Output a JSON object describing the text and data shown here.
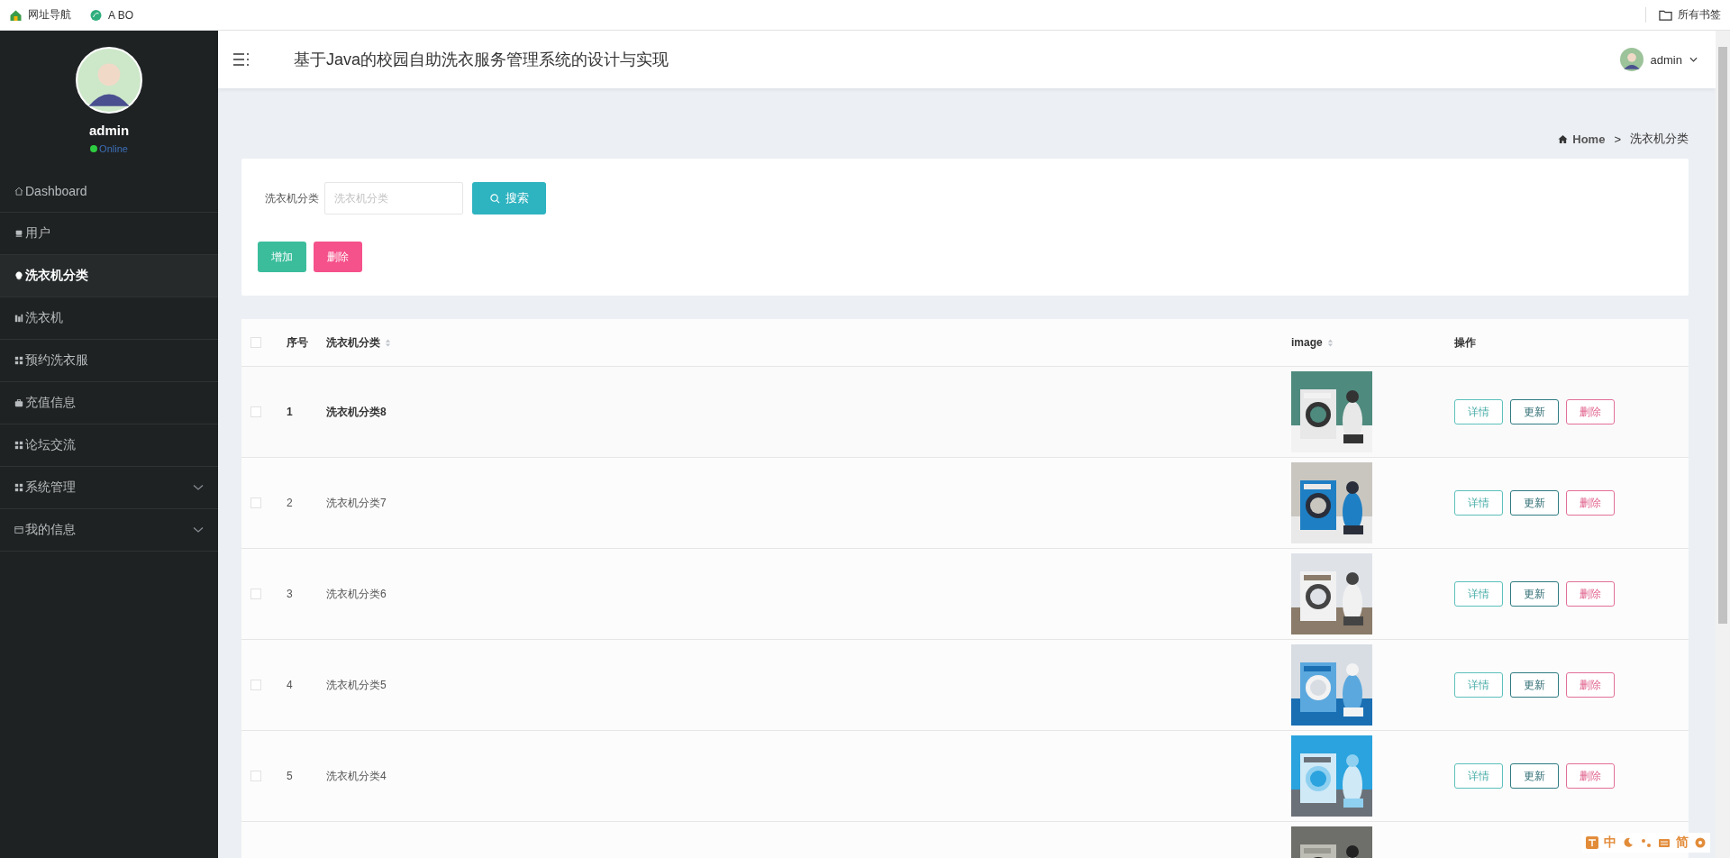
{
  "bookmarks_bar": {
    "items": [
      {
        "label": "网址导航"
      },
      {
        "label": "A BO"
      }
    ],
    "all_bookmarks": "所有书签"
  },
  "sidebar": {
    "user": {
      "name": "admin",
      "status": "Online"
    },
    "items": [
      {
        "label": "Dashboard",
        "selected": false,
        "has_submenu": false
      },
      {
        "label": "用户",
        "selected": false,
        "has_submenu": false
      },
      {
        "label": "洗衣机分类",
        "selected": true,
        "has_submenu": false
      },
      {
        "label": "洗衣机",
        "selected": false,
        "has_submenu": false
      },
      {
        "label": "预约洗衣服",
        "selected": false,
        "has_submenu": false
      },
      {
        "label": "充值信息",
        "selected": false,
        "has_submenu": false
      },
      {
        "label": "论坛交流",
        "selected": false,
        "has_submenu": false
      },
      {
        "label": "系统管理",
        "selected": false,
        "has_submenu": true
      },
      {
        "label": "我的信息",
        "selected": false,
        "has_submenu": true
      }
    ]
  },
  "header": {
    "title": "基于Java的校园自助洗衣服务管理系统的设计与实现",
    "user": "admin"
  },
  "breadcrumb": {
    "home": "Home",
    "separator": ">",
    "current": "洗衣机分类"
  },
  "search": {
    "label": "洗衣机分类",
    "placeholder": "洗衣机分类",
    "button": "搜索"
  },
  "actions": [
    {
      "label": "增加",
      "kind": "add"
    },
    {
      "label": "删除",
      "kind": "delete"
    }
  ],
  "table": {
    "header_checked": false,
    "columns": [
      {
        "label": "序号",
        "sortable": false
      },
      {
        "label": "洗衣机分类",
        "sortable": true
      },
      {
        "label": "image",
        "sortable": true
      },
      {
        "label": "操作",
        "sortable": false
      }
    ],
    "rows": [
      {
        "index": "1",
        "name": "洗衣机分类8",
        "selected": true,
        "checked": false,
        "buttons": [
          {
            "label": "详情",
            "kind": "detail"
          },
          {
            "label": "更新",
            "kind": "update"
          },
          {
            "label": "删除",
            "kind": "delete"
          }
        ]
      },
      {
        "index": "2",
        "name": "洗衣机分类7",
        "selected": false,
        "checked": false,
        "buttons": [
          {
            "label": "详情",
            "kind": "detail"
          },
          {
            "label": "更新",
            "kind": "update"
          },
          {
            "label": "删除",
            "kind": "delete"
          }
        ]
      },
      {
        "index": "3",
        "name": "洗衣机分类6",
        "selected": false,
        "checked": false,
        "buttons": [
          {
            "label": "详情",
            "kind": "detail"
          },
          {
            "label": "更新",
            "kind": "update"
          },
          {
            "label": "删除",
            "kind": "delete"
          }
        ]
      },
      {
        "index": "4",
        "name": "洗衣机分类5",
        "selected": false,
        "checked": false,
        "buttons": [
          {
            "label": "详情",
            "kind": "detail"
          },
          {
            "label": "更新",
            "kind": "update"
          },
          {
            "label": "删除",
            "kind": "delete"
          }
        ]
      },
      {
        "index": "5",
        "name": "洗衣机分类4",
        "selected": false,
        "checked": false,
        "buttons": [
          {
            "label": "详情",
            "kind": "detail"
          },
          {
            "label": "更新",
            "kind": "update"
          },
          {
            "label": "删除",
            "kind": "delete"
          }
        ]
      }
    ]
  },
  "ime_bar": {
    "mode": "中",
    "script": "简"
  }
}
